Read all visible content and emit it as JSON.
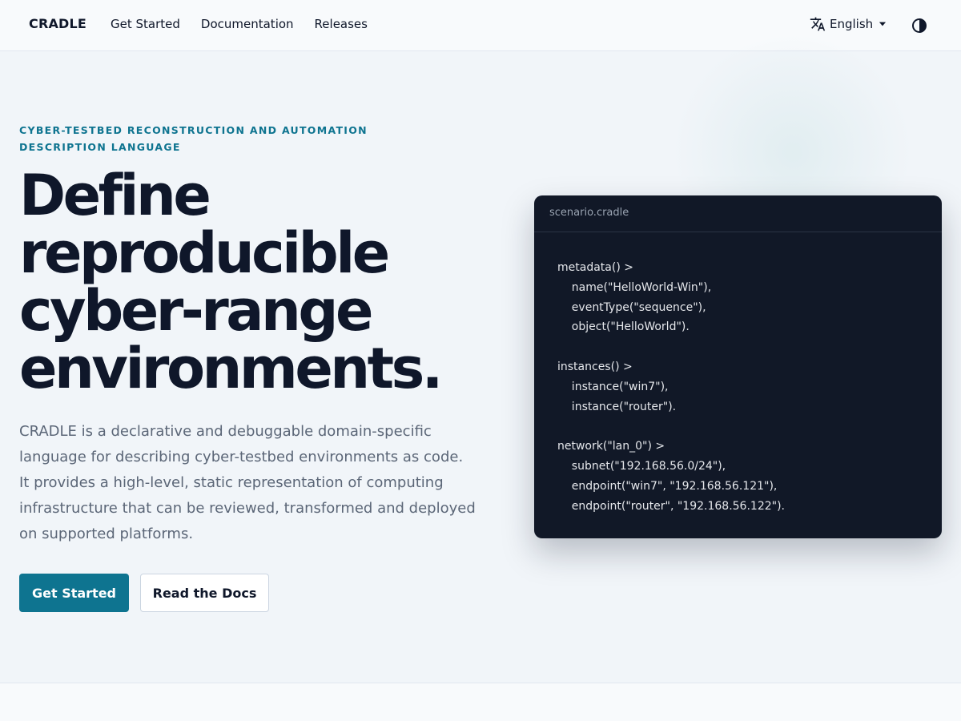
{
  "header": {
    "brand": "CRADLE",
    "nav": [
      "Get Started",
      "Documentation",
      "Releases"
    ],
    "language": "English",
    "icons": {
      "translate": "translate-icon",
      "dropdown": "caret-down-icon",
      "theme": "contrast-icon"
    }
  },
  "hero": {
    "eyebrow": "CYBER-TESTBED RECONSTRUCTION AND AUTOMATION DESCRIPTION LANGUAGE",
    "headline_lines": [
      "Define",
      "reproducible",
      "cyber-range",
      "environments."
    ],
    "lede": "CRADLE is a declarative and debuggable domain-specific language for describing cyber-testbed environments as code. It provides a high-level, static representation of computing infrastructure that can be reviewed, transformed and deployed on supported platforms.",
    "primary_cta": "Get Started",
    "secondary_cta": "Read the Docs"
  },
  "code_sample": {
    "filename": "scenario.cradle",
    "code": "metadata() >\n    name(\"HelloWorld-Win\"),\n    eventType(\"sequence\"),\n    object(\"HelloWorld\").\n\ninstances() >\n    instance(\"win7\"),\n    instance(\"router\").\n\nnetwork(\"lan_0\") >\n    subnet(\"192.168.56.0/24\"),\n    endpoint(\"win7\", \"192.168.56.121\"),\n    endpoint(\"router\", \"192.168.56.122\")."
  },
  "colors": {
    "accent": "#0e7490",
    "headline": "#0f172a",
    "body_text": "#5b6677",
    "page_bg": "#f1f5f9",
    "code_bg": "#111827"
  }
}
